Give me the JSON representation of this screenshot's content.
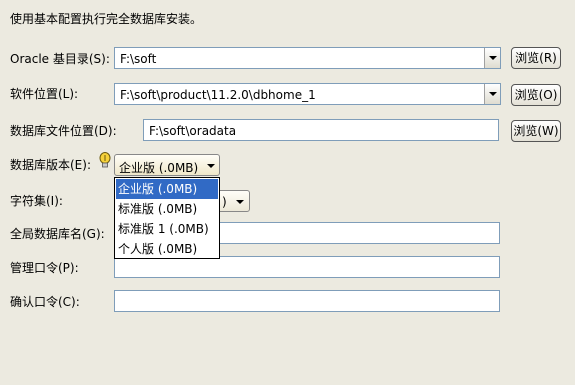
{
  "intro": "使用基本配置执行完全数据库安装。",
  "oracle_base": {
    "label": "Oracle 基目录(S):",
    "value": "F:\\soft",
    "browse": "浏览(R)"
  },
  "software_location": {
    "label": "软件位置(L):",
    "value": "F:\\soft\\product\\11.2.0\\dbhome_1",
    "browse": "浏览(O)"
  },
  "db_file_location": {
    "label": "数据库文件位置(D):",
    "value": "F:\\soft\\oradata",
    "browse": "浏览(W)"
  },
  "db_edition": {
    "label": "数据库版本(E):",
    "value": "企业版 (.0MB)",
    "options": [
      "企业版 (.0MB)",
      "标准版 (.0MB)",
      "标准版 1 (.0MB)",
      "个人版 (.0MB)"
    ],
    "selected_index": 0
  },
  "charset": {
    "label": "字符集(I):",
    "value_tail": ")"
  },
  "global_db_name": {
    "label": "全局数据库名(G):",
    "value": ""
  },
  "admin_password": {
    "label": "管理口令(P):",
    "value": ""
  },
  "confirm_password": {
    "label": "确认口令(C):",
    "value": ""
  },
  "colors": {
    "selection": "#316ac5",
    "background": "#eceae0",
    "border": "#7f9db9"
  },
  "icons": {
    "hint": "lightbulb-icon",
    "dropdown": "chevron-down-icon"
  }
}
